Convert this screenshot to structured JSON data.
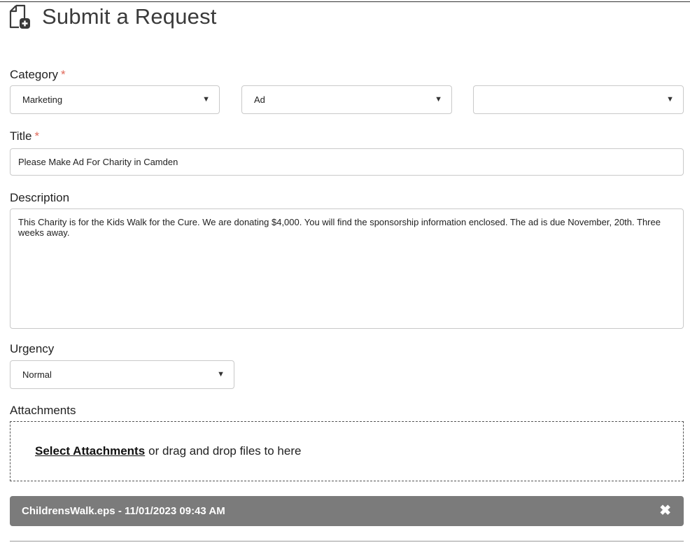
{
  "page": {
    "title": "Submit a Request",
    "icon": "file-add-icon"
  },
  "form": {
    "category": {
      "label": "Category",
      "required_mark": "*",
      "select1_value": "Marketing",
      "select2_value": "Ad",
      "select3_value": ""
    },
    "title_field": {
      "label": "Title",
      "required_mark": "*",
      "value": "Please Make Ad For Charity in Camden"
    },
    "description": {
      "label": "Description",
      "value": "This Charity is for the Kids Walk for the Cure. We are donating $4,000. You will find the sponsorship information enclosed. The ad is due November, 20th. Three weeks away."
    },
    "urgency": {
      "label": "Urgency",
      "value": "Normal"
    },
    "attachments": {
      "label": "Attachments",
      "select_link": "Select Attachments",
      "drop_text": "or drag and drop files to here",
      "files": [
        {
          "name": "ChildrensWalk.eps - 11/01/2023 09:43 AM",
          "remove_icon": "close-icon"
        }
      ]
    }
  },
  "glyphs": {
    "caret": "▼",
    "close": "✖"
  },
  "colors": {
    "required": "#e0695a",
    "file_bar": "#7b7b7b",
    "border": "#c9c9c9"
  }
}
